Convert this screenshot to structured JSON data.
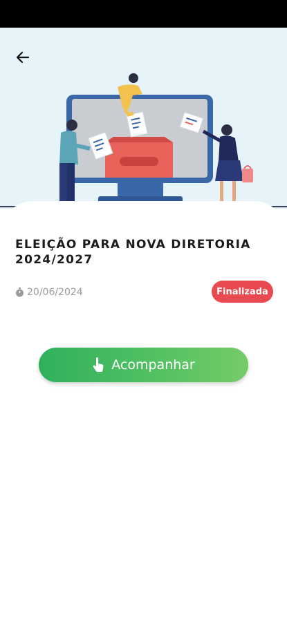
{
  "header": {
    "back_icon": "arrow-left-icon"
  },
  "hero": {
    "illustration": "voting-ballot-box-illustration"
  },
  "election": {
    "title_line1": "ELEIÇÃO PARA NOVA DIRETORIA",
    "title_line2": "2024/2027",
    "date": "20/06/2024",
    "date_icon": "stopwatch-icon",
    "status": "Finalizada",
    "status_color": "#e84a4f"
  },
  "actions": {
    "follow_label": "Acompanhar",
    "follow_icon": "hand-pointer-icon",
    "follow_color_start": "#2fb05c",
    "follow_color_end": "#74cc68"
  }
}
